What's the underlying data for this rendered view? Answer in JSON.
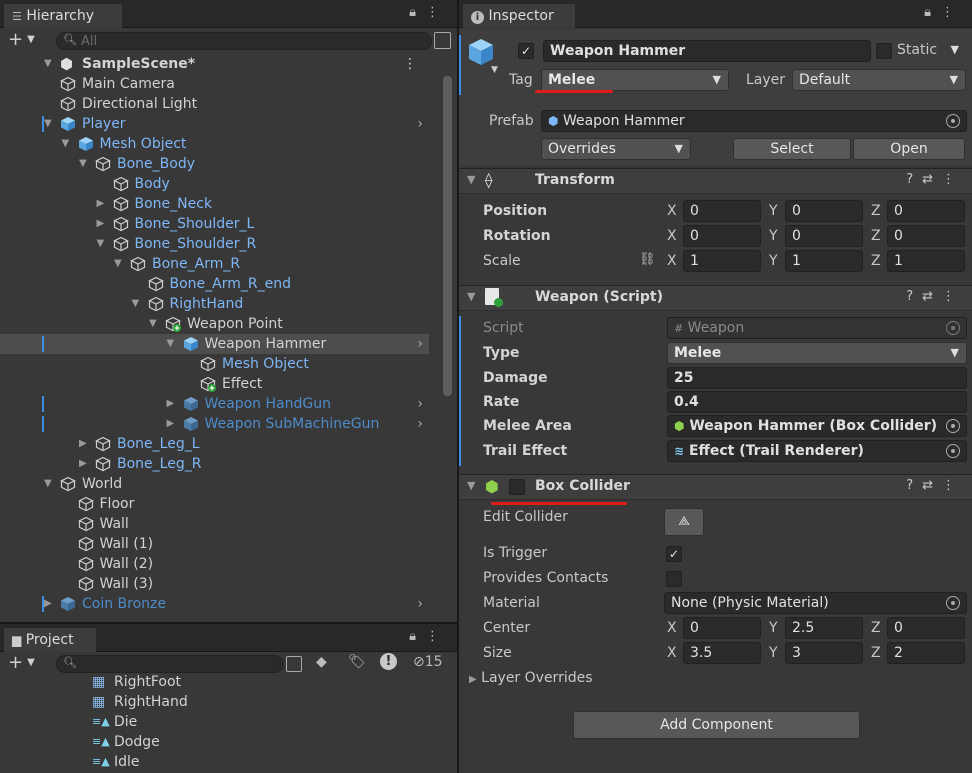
{
  "hierarchy": {
    "tab_label": "Hierarchy",
    "search_placeholder": "All",
    "scene_name": "SampleScene*",
    "items": [
      {
        "label": "Main Camera",
        "kind": "gameobject"
      },
      {
        "label": "Directional Light",
        "kind": "gameobject"
      },
      {
        "label": "Player",
        "kind": "prefab"
      },
      {
        "label": "Mesh Object",
        "kind": "prefab"
      },
      {
        "label": "Bone_Body",
        "kind": "gameobject"
      },
      {
        "label": "Body",
        "kind": "gameobject"
      },
      {
        "label": "Bone_Neck",
        "kind": "gameobject"
      },
      {
        "label": "Bone_Shoulder_L",
        "kind": "gameobject"
      },
      {
        "label": "Bone_Shoulder_R",
        "kind": "gameobject"
      },
      {
        "label": "Bone_Arm_R",
        "kind": "gameobject"
      },
      {
        "label": "Bone_Arm_R_end",
        "kind": "gameobject"
      },
      {
        "label": "RightHand",
        "kind": "gameobject"
      },
      {
        "label": "Weapon Point",
        "kind": "gameobject"
      },
      {
        "label": "Weapon Hammer",
        "kind": "prefab"
      },
      {
        "label": "Mesh Object",
        "kind": "gameobject"
      },
      {
        "label": "Effect",
        "kind": "gameobject"
      },
      {
        "label": "Weapon HandGun",
        "kind": "prefab"
      },
      {
        "label": "Weapon SubMachineGun",
        "kind": "prefab"
      },
      {
        "label": "Bone_Leg_L",
        "kind": "gameobject"
      },
      {
        "label": "Bone_Leg_R",
        "kind": "gameobject"
      },
      {
        "label": "World",
        "kind": "gameobject"
      },
      {
        "label": "Floor",
        "kind": "gameobject"
      },
      {
        "label": "Wall",
        "kind": "gameobject"
      },
      {
        "label": "Wall (1)",
        "kind": "gameobject"
      },
      {
        "label": "Wall (2)",
        "kind": "gameobject"
      },
      {
        "label": "Wall (3)",
        "kind": "gameobject"
      },
      {
        "label": "Coin Bronze",
        "kind": "prefab"
      }
    ]
  },
  "project": {
    "tab_label": "Project",
    "hidden_count": "15",
    "items": [
      {
        "label": "RightFoot",
        "kind": "avatar-mask"
      },
      {
        "label": "RightHand",
        "kind": "avatar-mask"
      },
      {
        "label": "Die",
        "kind": "animation"
      },
      {
        "label": "Dodge",
        "kind": "animation"
      },
      {
        "label": "Idle",
        "kind": "animation"
      }
    ]
  },
  "inspector": {
    "tab_label": "Inspector",
    "object_name": "Weapon Hammer",
    "static_label": "Static",
    "tag_label": "Tag",
    "tag_value": "Melee",
    "layer_label": "Layer",
    "layer_value": "Default",
    "prefab_label": "Prefab",
    "prefab_value": "Weapon Hammer",
    "overrides_label": "Overrides",
    "select_label": "Select",
    "open_label": "Open",
    "transform": {
      "title": "Transform",
      "position_label": "Position",
      "rotation_label": "Rotation",
      "scale_label": "Scale",
      "position": {
        "x": "0",
        "y": "0",
        "z": "0"
      },
      "rotation": {
        "x": "0",
        "y": "0",
        "z": "0"
      },
      "scale": {
        "x": "1",
        "y": "1",
        "z": "1"
      }
    },
    "weapon_script": {
      "title": "Weapon (Script)",
      "script_label": "Script",
      "script_value": "Weapon",
      "type_label": "Type",
      "type_value": "Melee",
      "damage_label": "Damage",
      "damage_value": "25",
      "rate_label": "Rate",
      "rate_value": "0.4",
      "melee_area_label": "Melee Area",
      "melee_area_value": "Weapon Hammer (Box Collider)",
      "trail_effect_label": "Trail Effect",
      "trail_effect_value": "Effect (Trail Renderer)"
    },
    "box_collider": {
      "title": "Box Collider",
      "edit_collider_label": "Edit Collider",
      "is_trigger_label": "Is Trigger",
      "is_trigger": true,
      "provides_contacts_label": "Provides Contacts",
      "provides_contacts": false,
      "material_label": "Material",
      "material_value": "None (Physic Material)",
      "center_label": "Center",
      "center": {
        "x": "0",
        "y": "2.5",
        "z": "0"
      },
      "size_label": "Size",
      "size": {
        "x": "3.5",
        "y": "3",
        "z": "2"
      },
      "layer_overrides_label": "Layer Overrides"
    },
    "add_component_label": "Add Component"
  },
  "axis": {
    "x": "X",
    "y": "Y",
    "z": "Z"
  },
  "colors": {
    "accent_red": "#e11b1b",
    "prefab_blue": "#7fb6f5",
    "selection": "#4d4d4d"
  }
}
